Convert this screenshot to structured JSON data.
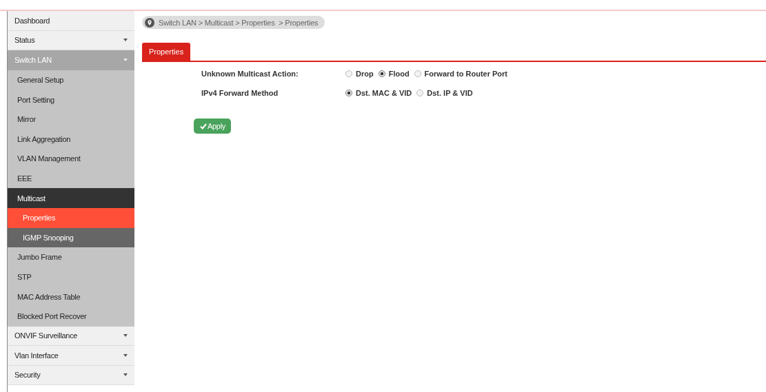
{
  "sidebar": {
    "items": [
      {
        "label": "Dashboard",
        "caret": false,
        "expanded": false,
        "selected": false
      },
      {
        "label": "Status",
        "caret": true,
        "expanded": false,
        "selected": false
      },
      {
        "label": "Switch LAN",
        "caret": true,
        "expanded": true,
        "selected": false,
        "children": [
          {
            "label": "General Setup",
            "expanded": false,
            "selected": false
          },
          {
            "label": "Port Setting",
            "expanded": false,
            "selected": false
          },
          {
            "label": "Mirror",
            "expanded": false,
            "selected": false
          },
          {
            "label": "Link Aggregation",
            "expanded": false,
            "selected": false
          },
          {
            "label": "VLAN Management",
            "expanded": false,
            "selected": false
          },
          {
            "label": "EEE",
            "expanded": false,
            "selected": false
          },
          {
            "label": "Multicast",
            "expanded": true,
            "selected": false,
            "children": [
              {
                "label": "Properties",
                "selected": true
              },
              {
                "label": "IGMP Snooping",
                "selected": false
              }
            ]
          },
          {
            "label": "Jumbo Frame",
            "expanded": false,
            "selected": false
          },
          {
            "label": "STP",
            "expanded": false,
            "selected": false
          },
          {
            "label": "MAC Address Table",
            "expanded": false,
            "selected": false
          },
          {
            "label": "Blocked Port Recover",
            "expanded": false,
            "selected": false
          }
        ]
      },
      {
        "label": "ONVIF Surveillance",
        "caret": true,
        "expanded": false,
        "selected": false
      },
      {
        "label": "Vlan Interface",
        "caret": true,
        "expanded": false,
        "selected": false
      },
      {
        "label": "Security",
        "caret": true,
        "expanded": false,
        "selected": false
      }
    ]
  },
  "breadcrumb": "Switch LAN > Multicast > Properties  > Properties",
  "tabs": [
    {
      "label": "Properties",
      "selected": true
    }
  ],
  "form": [
    {
      "label": "Unknown Multicast Action:",
      "options": [
        {
          "label": "Drop",
          "selected": false
        },
        {
          "label": "Flood",
          "selected": true
        },
        {
          "label": "Forward to Router Port",
          "selected": false
        }
      ]
    },
    {
      "label": "IPv4 Forward Method",
      "options": [
        {
          "label": "Dst. MAC & VID",
          "selected": true
        },
        {
          "label": "Dst. IP & VID",
          "selected": false
        }
      ]
    }
  ],
  "apply_button": "Apply"
}
